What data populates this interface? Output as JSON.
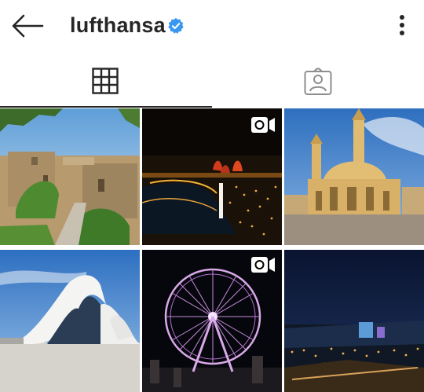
{
  "header": {
    "username": "lufthansa",
    "back_icon": "arrow-left-icon",
    "verified_icon": "verified-badge-icon",
    "more_icon": "more-vertical-icon"
  },
  "tabs": [
    {
      "id": "grid",
      "icon": "grid-icon",
      "active": true
    },
    {
      "id": "tagged",
      "icon": "tagged-user-icon",
      "active": false
    }
  ],
  "posts": [
    {
      "subject": "old-city-street",
      "type": "photo"
    },
    {
      "subject": "night-city-flame-towers",
      "type": "video"
    },
    {
      "subject": "mosque",
      "type": "photo"
    },
    {
      "subject": "heydar-aliyev-center",
      "type": "photo"
    },
    {
      "subject": "ferris-wheel-night",
      "type": "video"
    },
    {
      "subject": "night-skyline",
      "type": "photo"
    }
  ],
  "colors": {
    "text": "#262626",
    "verified_blue": "#3897f0",
    "divider": "#dbdbdb"
  }
}
